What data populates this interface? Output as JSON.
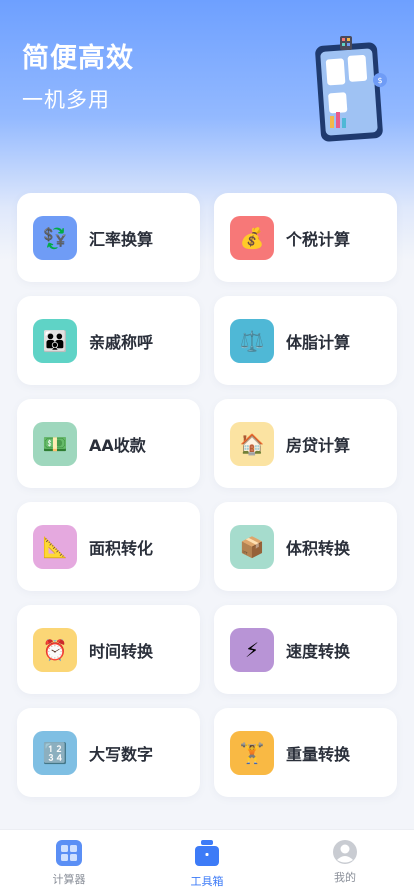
{
  "hero": {
    "title": "简便高效",
    "subtitle": "一机多用"
  },
  "tools": [
    {
      "label": "汇率换算",
      "icon": "currency-exchange-icon",
      "glyph": "💱",
      "color": "#6f9cf6"
    },
    {
      "label": "个税计算",
      "icon": "money-bag-icon",
      "glyph": "💰",
      "color": "#f77878"
    },
    {
      "label": "亲戚称呼",
      "icon": "family-icon",
      "glyph": "👪",
      "color": "#5fd3c6"
    },
    {
      "label": "体脂计算",
      "icon": "balance-scale-icon",
      "glyph": "⚖️",
      "color": "#4fb8d6"
    },
    {
      "label": "AA收款",
      "icon": "cash-icon",
      "glyph": "💵",
      "color": "#9ed7bd"
    },
    {
      "label": "房贷计算",
      "icon": "house-icon",
      "glyph": "🏠",
      "color": "#fbe3a2"
    },
    {
      "label": "面积转化",
      "icon": "ruler-icon",
      "glyph": "📐",
      "color": "#e5a9df"
    },
    {
      "label": "体积转换",
      "icon": "package-icon",
      "glyph": "📦",
      "color": "#a6dccd"
    },
    {
      "label": "时间转换",
      "icon": "alarm-clock-icon",
      "glyph": "⏰",
      "color": "#fbd676"
    },
    {
      "label": "速度转换",
      "icon": "lightning-icon",
      "glyph": "⚡",
      "color": "#b894d6"
    },
    {
      "label": "大写数字",
      "icon": "numbers-icon",
      "glyph": "🔢",
      "color": "#7fbfe3"
    },
    {
      "label": "重量转换",
      "icon": "weightlifter-icon",
      "glyph": "🏋",
      "color": "#f9b944"
    }
  ],
  "tabbar": {
    "items": [
      {
        "label": "计算器",
        "icon": "calculator-grid-icon",
        "active": false
      },
      {
        "label": "工具箱",
        "icon": "toolbox-icon",
        "active": true
      },
      {
        "label": "我的",
        "icon": "user-avatar-icon",
        "active": false
      }
    ]
  },
  "colors": {
    "accent": "#3d7bf7",
    "inactive": "#8a8f99"
  }
}
